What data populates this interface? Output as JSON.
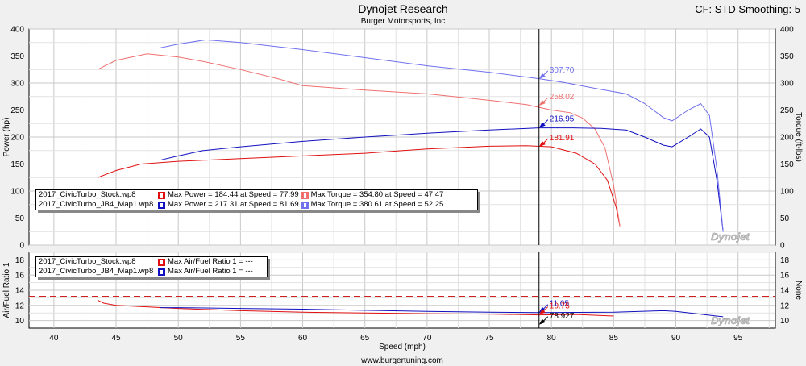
{
  "header": {
    "title": "Dynojet Research",
    "subtitle": "Burger Motorsports, Inc",
    "cf_label": "CF: STD Smoothing: 5",
    "footer_url": "www.burgertuning.com",
    "watermark": "Dynojet"
  },
  "colors": {
    "stock_power": "#e01010",
    "stock_torque": "#f07070",
    "jb4_power": "#1010c0",
    "jb4_torque": "#7070ee"
  },
  "legend_top": {
    "rows": [
      {
        "run": "2017_CivicTurbo_Stock.wp8",
        "power_text": "Max Power = 184.44 at Speed = 77.99",
        "torque_text": "Max Torque = 354.80 at Speed = 47.47",
        "power_color": "#e01010",
        "torque_color": "#f07070"
      },
      {
        "run": "2017_CivicTurbo_JB4_Map1.wp8",
        "power_text": "Max Power = 217.31 at Speed = 81.69",
        "torque_text": "Max Torque = 380.61 at Speed = 52.25",
        "power_color": "#1010c0",
        "torque_color": "#7070ee"
      }
    ]
  },
  "legend_bottom": {
    "rows": [
      {
        "run": "2017_CivicTurbo_Stock.wp8",
        "afr_text": "Max Air/Fuel Ratio 1 = ---",
        "color": "#e01010"
      },
      {
        "run": "2017_CivicTurbo_JB4_Map1.wp8",
        "afr_text": "Max Air/Fuel Ratio 1 = ---",
        "color": "#1010c0"
      }
    ]
  },
  "chart_data": [
    {
      "type": "line",
      "xlabel": "Speed (mph)",
      "ylabel": "Power (hp)",
      "y2label": "Torque (ft-lbs)",
      "xlim": [
        38,
        98
      ],
      "ylim": [
        0,
        400
      ],
      "y2lim": [
        0,
        400
      ],
      "x_ticks": [
        40,
        45,
        50,
        55,
        60,
        65,
        70,
        75,
        80,
        85,
        90,
        95
      ],
      "y_ticks": [
        0,
        50,
        100,
        150,
        200,
        250,
        300,
        350,
        400
      ],
      "grid": true,
      "cursor_x": 79,
      "series": [
        {
          "name": "2017_CivicTurbo_Stock.wp8",
          "measure": "power",
          "color": "#e01010",
          "x": [
            43.5,
            45,
            47,
            50,
            55,
            60,
            65,
            70,
            75,
            78,
            80,
            82,
            83.5,
            84.5,
            85.2,
            85.5
          ],
          "y": [
            125,
            138,
            150,
            155,
            160,
            165,
            170,
            178,
            183,
            184,
            182,
            170,
            150,
            120,
            70,
            35
          ]
        },
        {
          "name": "2017_CivicTurbo_Stock.wp8",
          "measure": "torque",
          "color": "#f07070",
          "x": [
            43.5,
            45,
            47.5,
            50,
            52,
            55,
            58,
            60,
            65,
            70,
            75,
            78,
            80,
            81.5,
            82.5,
            83.5,
            84.3,
            85,
            85.5
          ],
          "y": [
            325,
            342,
            354,
            348,
            340,
            325,
            308,
            295,
            287,
            280,
            268,
            260,
            250,
            245,
            235,
            215,
            180,
            110,
            35
          ]
        },
        {
          "name": "2017_CivicTurbo_JB4_Map1.wp8",
          "measure": "power",
          "color": "#1010c0",
          "x": [
            48.5,
            50,
            52,
            55,
            60,
            65,
            70,
            75,
            79,
            81.7,
            84,
            86,
            87.5,
            89,
            89.7,
            91,
            92,
            92.7,
            93.3,
            93.8
          ],
          "y": [
            157,
            165,
            175,
            182,
            192,
            200,
            207,
            213,
            217,
            217,
            216,
            213,
            200,
            185,
            182,
            200,
            215,
            200,
            120,
            25
          ]
        },
        {
          "name": "2017_CivicTurbo_JB4_Map1.wp8",
          "measure": "torque",
          "color": "#7070ee",
          "x": [
            48.5,
            50,
            52.2,
            55,
            60,
            65,
            70,
            75,
            79,
            81,
            84,
            86,
            87.5,
            89,
            89.7,
            91,
            92,
            92.7,
            93.3,
            93.8
          ],
          "y": [
            365,
            372,
            380,
            375,
            362,
            347,
            332,
            320,
            308,
            301,
            288,
            280,
            262,
            236,
            230,
            250,
            262,
            240,
            140,
            25
          ]
        }
      ],
      "cursor_labels": [
        {
          "text": "307.70",
          "y": 307.7,
          "color": "#7070ee"
        },
        {
          "text": "258.02",
          "y": 258.02,
          "color": "#f07070"
        },
        {
          "text": "216.95",
          "y": 216.95,
          "color": "#1010c0"
        },
        {
          "text": "181.91",
          "y": 181.91,
          "color": "#e01010"
        }
      ]
    },
    {
      "type": "line",
      "xlabel": "Speed (mph)",
      "ylabel": "Air/Fuel Ratio 1",
      "y2label": "None",
      "xlim": [
        38,
        98
      ],
      "ylim": [
        9,
        19
      ],
      "y2lim": [
        9,
        19
      ],
      "y_ticks": [
        10,
        12,
        14,
        16,
        18
      ],
      "grid": true,
      "reference_line_y": 13.2,
      "cursor_x": 79,
      "series": [
        {
          "name": "2017_CivicTurbo_Stock.wp8",
          "measure": "afr",
          "color": "#e01010",
          "x": [
            43.5,
            44,
            45,
            50,
            55,
            60,
            65,
            70,
            75,
            79,
            82,
            85
          ],
          "y": [
            12.7,
            12.3,
            12.0,
            11.6,
            11.3,
            11.1,
            11.0,
            10.9,
            10.85,
            10.75,
            10.8,
            10.6
          ]
        },
        {
          "name": "2017_CivicTurbo_JB4_Map1.wp8",
          "measure": "afr",
          "color": "#1010c0",
          "x": [
            48.5,
            50,
            55,
            60,
            65,
            70,
            75,
            79,
            85,
            89,
            90,
            93.8
          ],
          "y": [
            11.7,
            11.7,
            11.6,
            11.5,
            11.35,
            11.2,
            11.1,
            11.05,
            11.1,
            11.3,
            11.2,
            10.5
          ]
        }
      ],
      "cursor_labels": [
        {
          "text": "11.05",
          "y": 11.05,
          "color": "#1010c0"
        },
        {
          "text": "10.75",
          "y": 10.75,
          "color": "#e01010"
        },
        {
          "text": "78.927",
          "y": 9.45,
          "color": "#000000"
        }
      ]
    }
  ]
}
